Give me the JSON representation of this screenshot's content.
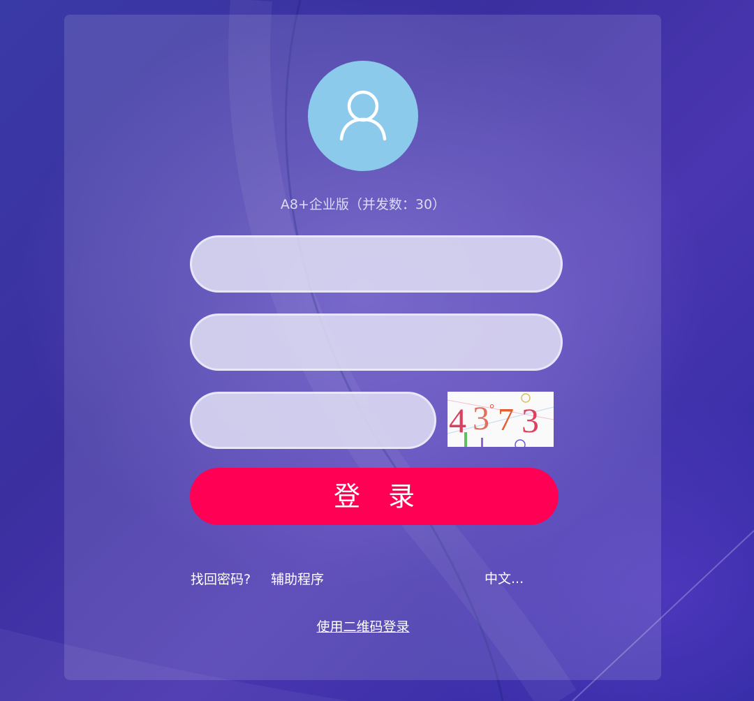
{
  "login": {
    "edition_text": "A8+企业版（并发数：30）",
    "username_value": "",
    "password_value": "",
    "captcha_value": "",
    "captcha_text": "4373",
    "login_button": "登 录"
  },
  "links": {
    "forgot_password": "找回密码?",
    "helper_program": "辅助程序",
    "language": "中文...",
    "qr_login": "使用二维码登录"
  },
  "colors": {
    "login_button": "#ff0055",
    "avatar_bg": "#8ccaec"
  },
  "icons": {
    "avatar": "user-icon"
  }
}
